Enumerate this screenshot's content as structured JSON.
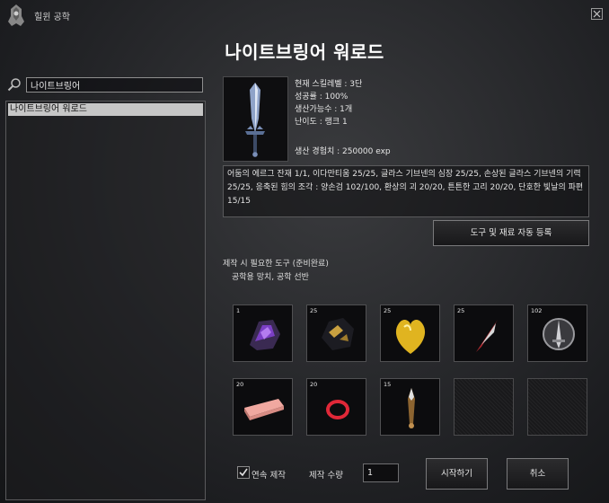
{
  "window": {
    "title": "힐윈 공학"
  },
  "item_name": "나이트브링어 워로드",
  "search": {
    "value": "나이트브링어"
  },
  "recipe_list": [
    "나이트브링어 워로드"
  ],
  "info": {
    "skill_level": "현재 스킬레벨 : 3단",
    "success_rate": "성공률 : 100%",
    "production_count": "생산가능수 : 1개",
    "difficulty": "난이도 : 랭크 1",
    "experience": "생산 경험치 : 250000 exp"
  },
  "description": "어둠의 에르그 잔재 1/1, 이다만티움 25/25, 글라스 기브넨의 심장 25/25, 손상된 글라스 기브넨의 기력 25/25, 응축된 힘의 조각 : 양손검 102/100, 환상의 괴 20/20, 튼튼한 고리 20/20, 단호한 빛날의 파편 15/15",
  "auto_register_button": "도구 및 재료 자동 등록",
  "tools": {
    "label": "제작 시 필요한 도구 (준비완료)",
    "value": "공학용 망치, 공학 선반"
  },
  "materials": [
    {
      "qty": "1",
      "icon": "purple-crystal-icon"
    },
    {
      "qty": "25",
      "icon": "dark-gold-ore-icon"
    },
    {
      "qty": "25",
      "icon": "golden-heart-icon"
    },
    {
      "qty": "25",
      "icon": "red-feather-icon"
    },
    {
      "qty": "102",
      "icon": "sword-emblem-icon"
    },
    {
      "qty": "20",
      "icon": "pink-ingot-icon"
    },
    {
      "qty": "20",
      "icon": "red-ring-icon"
    },
    {
      "qty": "15",
      "icon": "blade-shard-icon"
    },
    {
      "qty": "",
      "icon": "empty-slot"
    },
    {
      "qty": "",
      "icon": "empty-slot"
    }
  ],
  "footer": {
    "continuous_label": "연속 제작",
    "quantity_label": "제작 수량",
    "quantity_value": "1",
    "start_button": "시작하기",
    "cancel_button": "취소"
  },
  "colors": {
    "selected_row": "#c6c6c6",
    "background": "#2a2b2e"
  }
}
